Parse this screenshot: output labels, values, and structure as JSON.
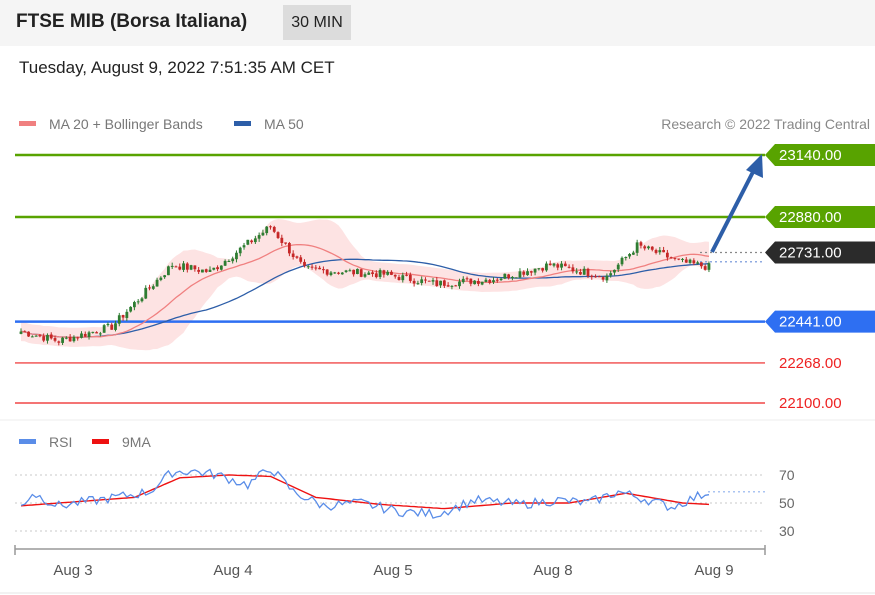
{
  "header": {
    "title": "FTSE MIB (Borsa Italiana)",
    "timeframe": "30 MIN"
  },
  "datetime": "Tuesday, August 9, 2022 7:51:35 AM CET",
  "colors": {
    "resistance": "#58a300",
    "pivot": "#2b2b2b",
    "support": "#2e6ff2",
    "support_weak": "#ee2222",
    "ma20": "#f08080",
    "ma50": "#2d5ea8",
    "bollinger_fill": "#fde3e3",
    "candle_up": "#2e7d32",
    "candle_down": "#c62828",
    "rsi": "#5a8de8",
    "rsi_9ma": "#ee1111",
    "arrow": "#2d5ea8"
  },
  "chart_data": [
    {
      "type": "candlestick",
      "title": "FTSE MIB (Borsa Italiana)",
      "legend": [
        {
          "name": "MA 20 + Bollinger Bands",
          "color": "#f08080"
        },
        {
          "name": "MA 50",
          "color": "#2d5ea8"
        }
      ],
      "credit": "Research © 2022 Trading Central",
      "x_labels": [
        "Aug 3",
        "Aug 4",
        "Aug 5",
        "Aug 8",
        "Aug 9"
      ],
      "levels": [
        {
          "value": 23140.0,
          "label": "23140.00",
          "kind": "resistance"
        },
        {
          "value": 22880.0,
          "label": "22880.00",
          "kind": "resistance"
        },
        {
          "value": 22731.0,
          "label": "22731.00",
          "kind": "pivot"
        },
        {
          "value": 22441.0,
          "label": "22441.00",
          "kind": "support"
        },
        {
          "value": 22268.0,
          "label": "22268.00",
          "kind": "support_weak"
        },
        {
          "value": 22100.0,
          "label": "22100.00",
          "kind": "support_weak"
        }
      ],
      "price_path_key_points": [
        {
          "bar": 0,
          "close": 22400
        },
        {
          "bar": 10,
          "close": 22360
        },
        {
          "bar": 24,
          "close": 22420
        },
        {
          "bar": 40,
          "close": 22680
        },
        {
          "bar": 50,
          "close": 22650
        },
        {
          "bar": 66,
          "close": 22840
        },
        {
          "bar": 75,
          "close": 22660
        },
        {
          "bar": 96,
          "close": 22640
        },
        {
          "bar": 110,
          "close": 22600
        },
        {
          "bar": 125,
          "close": 22620
        },
        {
          "bar": 140,
          "close": 22680
        },
        {
          "bar": 155,
          "close": 22630
        },
        {
          "bar": 163,
          "close": 22760
        },
        {
          "bar": 175,
          "close": 22690
        },
        {
          "bar": 182,
          "close": 22670
        }
      ],
      "forecast": {
        "from": 22731.0,
        "to": 23140.0,
        "direction": "up"
      }
    },
    {
      "type": "line",
      "title": "RSI",
      "legend": [
        {
          "name": "RSI",
          "color": "#5a8de8"
        },
        {
          "name": "9MA",
          "color": "#ee1111"
        }
      ],
      "y_ticks": [
        70,
        50,
        30
      ],
      "ylim": [
        20,
        80
      ],
      "rsi_key_points": [
        {
          "bar": 0,
          "value": 48
        },
        {
          "bar": 3,
          "value": 57
        },
        {
          "bar": 10,
          "value": 48
        },
        {
          "bar": 25,
          "value": 54
        },
        {
          "bar": 34,
          "value": 58
        },
        {
          "bar": 40,
          "value": 72
        },
        {
          "bar": 45,
          "value": 73
        },
        {
          "bar": 52,
          "value": 70
        },
        {
          "bar": 60,
          "value": 63
        },
        {
          "bar": 66,
          "value": 75
        },
        {
          "bar": 72,
          "value": 58
        },
        {
          "bar": 80,
          "value": 48
        },
        {
          "bar": 90,
          "value": 50
        },
        {
          "bar": 100,
          "value": 44
        },
        {
          "bar": 110,
          "value": 42
        },
        {
          "bar": 120,
          "value": 52
        },
        {
          "bar": 132,
          "value": 49
        },
        {
          "bar": 142,
          "value": 52
        },
        {
          "bar": 150,
          "value": 50
        },
        {
          "bar": 158,
          "value": 58
        },
        {
          "bar": 165,
          "value": 53
        },
        {
          "bar": 172,
          "value": 47
        },
        {
          "bar": 182,
          "value": 58
        }
      ],
      "ma9_key_points": [
        {
          "bar": 0,
          "value": 48
        },
        {
          "bar": 15,
          "value": 51
        },
        {
          "bar": 30,
          "value": 54
        },
        {
          "bar": 42,
          "value": 68
        },
        {
          "bar": 55,
          "value": 70
        },
        {
          "bar": 66,
          "value": 69
        },
        {
          "bar": 78,
          "value": 54
        },
        {
          "bar": 95,
          "value": 49
        },
        {
          "bar": 112,
          "value": 46
        },
        {
          "bar": 130,
          "value": 50
        },
        {
          "bar": 145,
          "value": 50
        },
        {
          "bar": 160,
          "value": 57
        },
        {
          "bar": 175,
          "value": 50
        },
        {
          "bar": 182,
          "value": 49
        }
      ],
      "last_value": 58
    }
  ]
}
